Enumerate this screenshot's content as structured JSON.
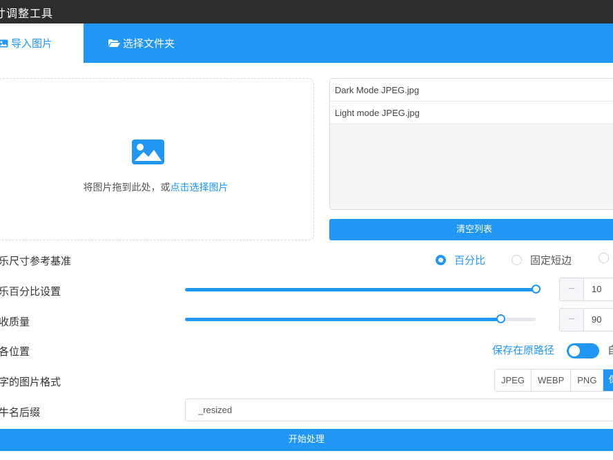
{
  "app": {
    "title": "寸调整工具"
  },
  "tabs": [
    {
      "label": "导入图片",
      "icon": "image-icon",
      "active": true
    },
    {
      "label": "选择文件夹",
      "icon": "folder-open-icon",
      "active": false
    }
  ],
  "dropzone": {
    "icon": "image-icon",
    "hint_text": "将图片拖到此处，或",
    "hint_link": "点击选择图片"
  },
  "files": [
    "Dark Mode JPEG.jpg",
    "Light mode JPEG.jpg"
  ],
  "clear_button": "清空列表",
  "settings": {
    "size_basis": {
      "label": "乐尺寸参考基准",
      "options": [
        {
          "label": "百分比",
          "checked": true
        },
        {
          "label": "固定短边",
          "checked": false
        }
      ]
    },
    "percent": {
      "label": "乐百分比设置",
      "value": "10",
      "slider_fraction": 1.0
    },
    "quality": {
      "label": "收质量",
      "value": "90",
      "slider_fraction": 0.9
    },
    "save_location": {
      "label": "各位置",
      "toggle_left_label": "保存在原路径",
      "toggle_right_label": "自",
      "toggle_on": true
    },
    "format": {
      "label": "字的图片格式",
      "options": [
        "JPEG",
        "WEBP",
        "PNG",
        "保"
      ],
      "selected_index": 3
    },
    "suffix": {
      "label": "牛名后缀",
      "value": "_resized"
    }
  },
  "start_button": "开始处理",
  "colors": {
    "accent": "#2196f3",
    "titlebar": "#2d2d2d"
  }
}
